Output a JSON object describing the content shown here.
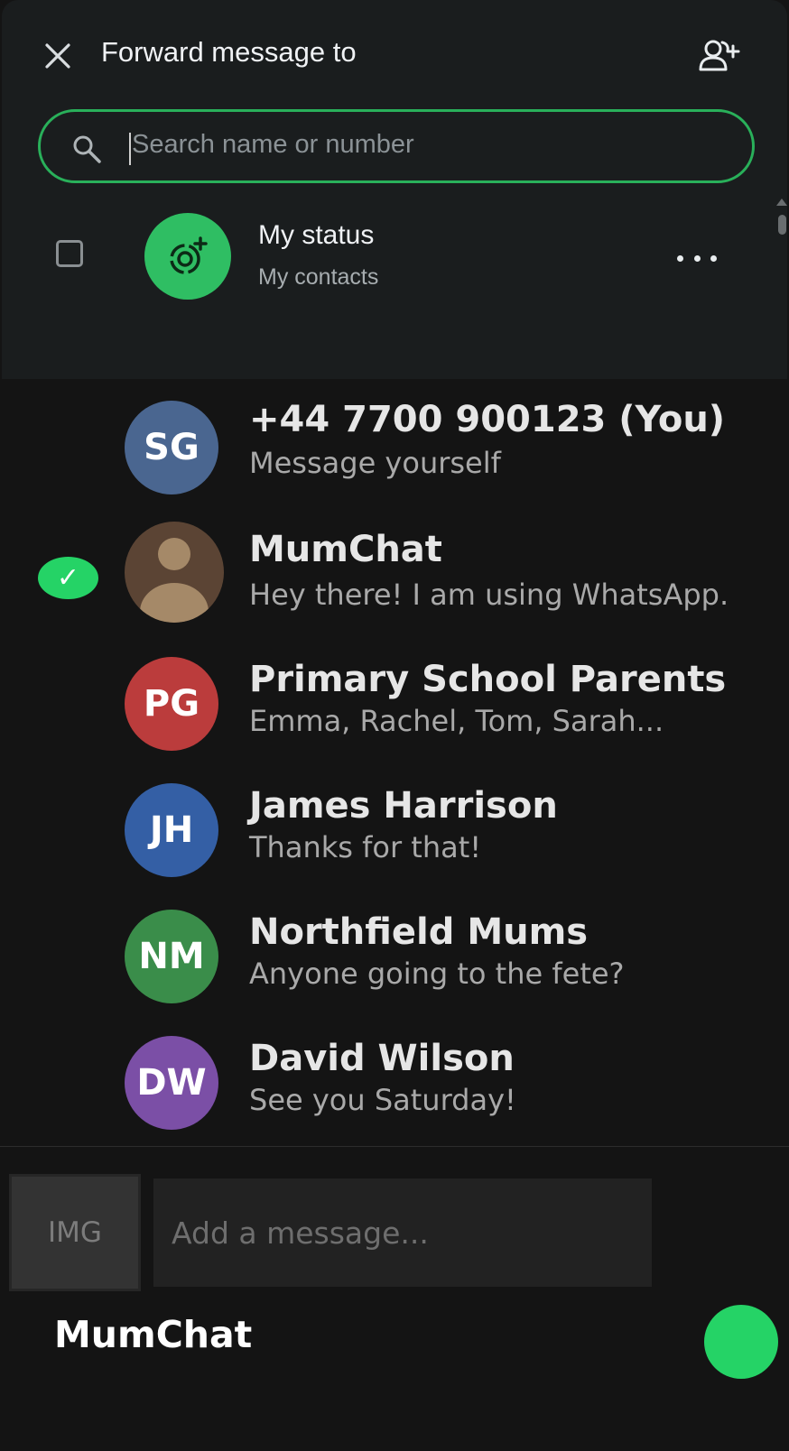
{
  "header": {
    "title": "Forward message to",
    "close_icon": "close-icon",
    "add_contact_icon": "add-contact-icon"
  },
  "search": {
    "placeholder": "Search name or number",
    "icon": "search-icon"
  },
  "status_row": {
    "name": "My status",
    "subtitle": "My contacts",
    "checked": false,
    "avatar_color": "#2fbe63"
  },
  "contacts": [
    {
      "initials": "SG",
      "name": "+44 7700 900123 (You)",
      "subtitle": "Message yourself",
      "color": "#4a6690",
      "selected": false
    },
    {
      "initials": "",
      "name": "MumChat",
      "subtitle": "Hey there! I am using WhatsApp.",
      "color": "#5b4434",
      "selected": true,
      "photo": true
    },
    {
      "initials": "PG",
      "name": "Primary School Parents",
      "subtitle": "Emma, Rachel, Tom, Sarah...",
      "color": "#bb3c3c",
      "selected": false
    },
    {
      "initials": "JH",
      "name": "James Harrison",
      "subtitle": "Thanks for that!",
      "color": "#345fa5",
      "selected": false
    },
    {
      "initials": "NM",
      "name": "Northfield Mums",
      "subtitle": "Anyone going to the fete?",
      "color": "#3a8d4a",
      "selected": false
    },
    {
      "initials": "DW",
      "name": "David Wilson",
      "subtitle": "See you Saturday!",
      "color": "#7b4fa6",
      "selected": false
    }
  ],
  "composer": {
    "image_label": "IMG",
    "message_placeholder": "Add a message...",
    "recipients_text": "MumChat"
  },
  "colors": {
    "accent": "#25d366",
    "search_border": "#29b05a"
  }
}
